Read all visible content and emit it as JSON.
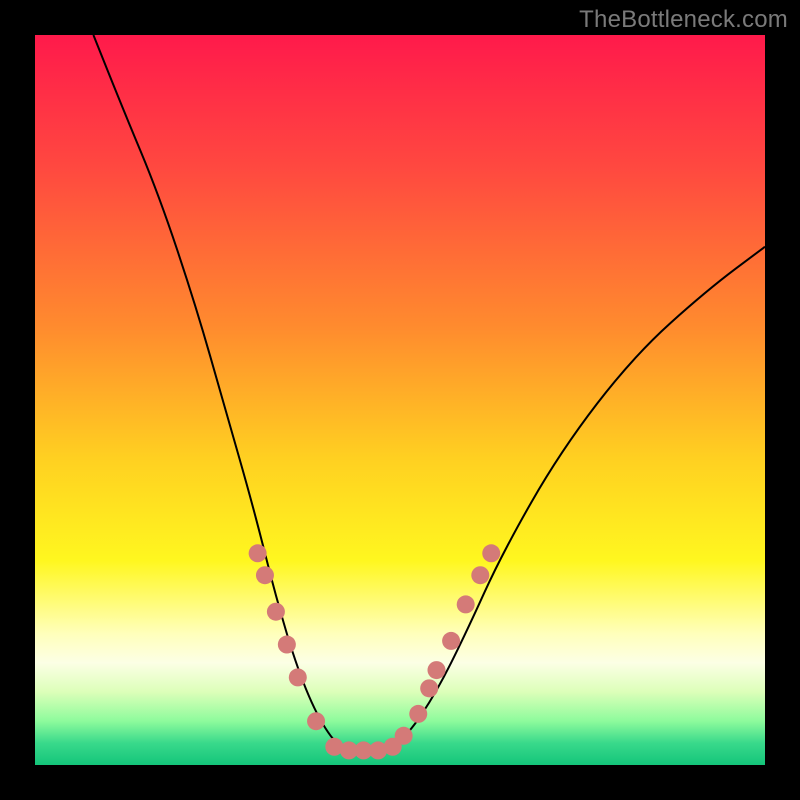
{
  "watermark": "TheBottleneck.com",
  "chart_data": {
    "type": "line",
    "title": "",
    "xlabel": "",
    "ylabel": "",
    "xlim": [
      0,
      100
    ],
    "ylim": [
      0,
      100
    ],
    "background_gradient_stops": [
      {
        "offset": 0,
        "color": "#ff1a4b"
      },
      {
        "offset": 0.18,
        "color": "#ff4840"
      },
      {
        "offset": 0.4,
        "color": "#ff8b2e"
      },
      {
        "offset": 0.58,
        "color": "#ffd021"
      },
      {
        "offset": 0.72,
        "color": "#fff71f"
      },
      {
        "offset": 0.82,
        "color": "#ffffbb"
      },
      {
        "offset": 0.86,
        "color": "#fcffe5"
      },
      {
        "offset": 0.9,
        "color": "#dcffb9"
      },
      {
        "offset": 0.94,
        "color": "#8dfb9c"
      },
      {
        "offset": 0.97,
        "color": "#39d98b"
      },
      {
        "offset": 1.0,
        "color": "#14c57a"
      }
    ],
    "series": [
      {
        "name": "bottleneck-curve",
        "color": "#000000",
        "stroke_width": 2,
        "points": [
          {
            "x": 8,
            "y": 100
          },
          {
            "x": 12,
            "y": 90
          },
          {
            "x": 17,
            "y": 78
          },
          {
            "x": 22,
            "y": 63
          },
          {
            "x": 26,
            "y": 49
          },
          {
            "x": 30,
            "y": 35
          },
          {
            "x": 33,
            "y": 23
          },
          {
            "x": 36,
            "y": 13
          },
          {
            "x": 39,
            "y": 6
          },
          {
            "x": 42,
            "y": 2
          },
          {
            "x": 45,
            "y": 2
          },
          {
            "x": 48,
            "y": 2
          },
          {
            "x": 51,
            "y": 4
          },
          {
            "x": 55,
            "y": 10
          },
          {
            "x": 59,
            "y": 18
          },
          {
            "x": 64,
            "y": 29
          },
          {
            "x": 72,
            "y": 43
          },
          {
            "x": 82,
            "y": 56
          },
          {
            "x": 92,
            "y": 65
          },
          {
            "x": 100,
            "y": 71
          }
        ]
      }
    ],
    "markers": {
      "color": "#d47a78",
      "radius": 9,
      "points": [
        {
          "x": 30.5,
          "y": 29
        },
        {
          "x": 31.5,
          "y": 26
        },
        {
          "x": 33.0,
          "y": 21
        },
        {
          "x": 34.5,
          "y": 16.5
        },
        {
          "x": 36.0,
          "y": 12
        },
        {
          "x": 38.5,
          "y": 6
        },
        {
          "x": 41.0,
          "y": 2.5
        },
        {
          "x": 43.0,
          "y": 2
        },
        {
          "x": 45.0,
          "y": 2
        },
        {
          "x": 47.0,
          "y": 2
        },
        {
          "x": 49.0,
          "y": 2.5
        },
        {
          "x": 50.5,
          "y": 4
        },
        {
          "x": 52.5,
          "y": 7
        },
        {
          "x": 54.0,
          "y": 10.5
        },
        {
          "x": 55.0,
          "y": 13
        },
        {
          "x": 57.0,
          "y": 17
        },
        {
          "x": 59.0,
          "y": 22
        },
        {
          "x": 61.0,
          "y": 26
        },
        {
          "x": 62.5,
          "y": 29
        }
      ]
    }
  }
}
